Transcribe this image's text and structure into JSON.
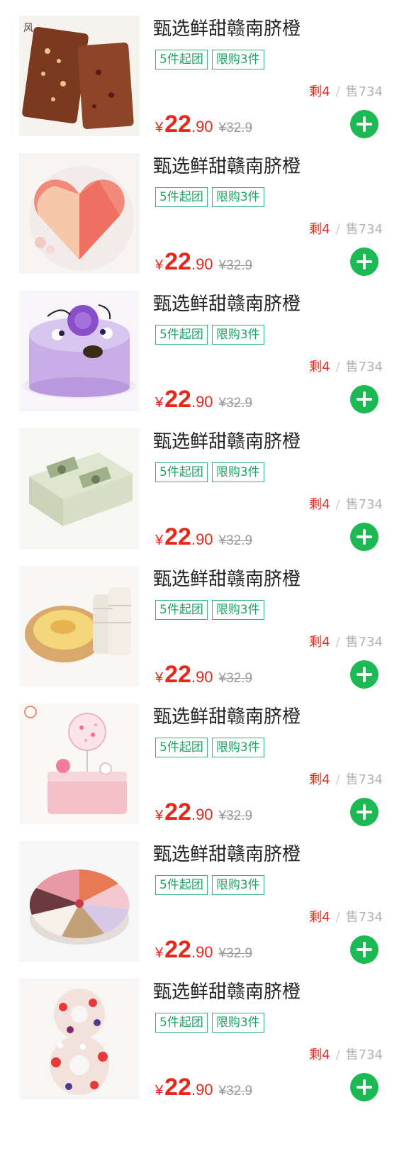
{
  "products": [
    {
      "title": "甄选鲜甜赣南脐橙",
      "tags": [
        "5件起团",
        "限购3件"
      ],
      "remaining": "剩4",
      "sold": "售734",
      "currency": "¥",
      "price_int": "22",
      "price_dec": ".90",
      "original_price": "¥32.9",
      "image": "pound-cake-icon"
    },
    {
      "title": "甄选鲜甜赣南脐橙",
      "tags": [
        "5件起团",
        "限购3件"
      ],
      "remaining": "剩4",
      "sold": "售734",
      "currency": "¥",
      "price_int": "22",
      "price_dec": ".90",
      "original_price": "¥32.9",
      "image": "heart-mousse-icon"
    },
    {
      "title": "甄选鲜甜赣南脐橙",
      "tags": [
        "5件起团",
        "限购3件"
      ],
      "remaining": "剩4",
      "sold": "售734",
      "currency": "¥",
      "price_int": "22",
      "price_dec": ".90",
      "original_price": "¥32.9",
      "image": "lavender-cake-icon"
    },
    {
      "title": "甄选鲜甜赣南脐橙",
      "tags": [
        "5件起团",
        "限购3件"
      ],
      "remaining": "剩4",
      "sold": "售734",
      "currency": "¥",
      "price_int": "22",
      "price_dec": ".90",
      "original_price": "¥32.9",
      "image": "money-cake-icon"
    },
    {
      "title": "甄选鲜甜赣南脐橙",
      "tags": [
        "5件起团",
        "限购3件"
      ],
      "remaining": "剩4",
      "sold": "售734",
      "currency": "¥",
      "price_int": "22",
      "price_dec": ".90",
      "original_price": "¥32.9",
      "image": "egg-tart-icon"
    },
    {
      "title": "甄选鲜甜赣南脐橙",
      "tags": [
        "5件起团",
        "限购3件"
      ],
      "remaining": "剩4",
      "sold": "售734",
      "currency": "¥",
      "price_int": "22",
      "price_dec": ".90",
      "original_price": "¥32.9",
      "image": "balloon-cake-icon"
    },
    {
      "title": "甄选鲜甜赣南脐橙",
      "tags": [
        "5件起团",
        "限购3件"
      ],
      "remaining": "剩4",
      "sold": "售734",
      "currency": "¥",
      "price_int": "22",
      "price_dec": ".90",
      "original_price": "¥32.9",
      "image": "sampler-cake-icon"
    },
    {
      "title": "甄选鲜甜赣南脐橙",
      "tags": [
        "5件起团",
        "限购3件"
      ],
      "remaining": "剩4",
      "sold": "售734",
      "currency": "¥",
      "price_int": "22",
      "price_dec": ".90",
      "original_price": "¥32.9",
      "image": "number-eight-cake-icon"
    }
  ],
  "colors": {
    "accent_red": "#e8261a",
    "tag_green": "#1fa567",
    "add_button_green": "#1db954"
  }
}
